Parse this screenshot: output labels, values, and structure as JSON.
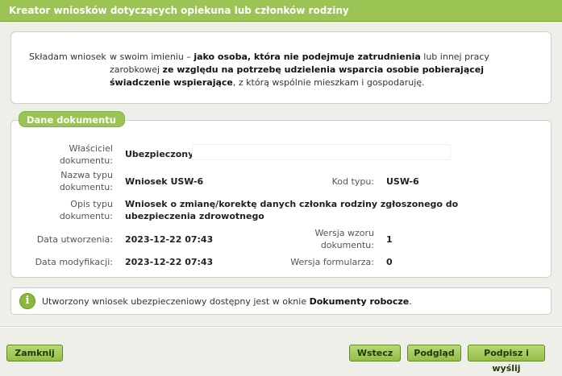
{
  "window": {
    "title": "Kreator wniosków dotyczących opiekuna lub członków rodziny"
  },
  "intro": {
    "label": "Składam wniosek",
    "text_1": "w swoim imieniu – ",
    "text_2": "jako osoba, która nie podejmuje zatrudnienia",
    "text_3": " lub innej pracy zarobkowej ",
    "text_4": "ze względu na potrzebę udzielenia wsparcia osobie pobierającej świadczenie wspierające",
    "text_5": ", z którą wspólnie mieszkam i gospodaruję."
  },
  "document": {
    "section_title": "Dane dokumentu",
    "owner_label": "Właściciel dokumentu:",
    "owner_value": "Ubezpieczony",
    "type_name_label": "Nazwa typu dokumentu:",
    "type_name_value": "Wniosek USW-6",
    "type_code_label": "Kod typu:",
    "type_code_value": "USW-6",
    "type_desc_label": "Opis typu dokumentu:",
    "type_desc_value": "Wniosek o zmianę/korektę danych członka rodziny zgłoszonego do ubezpieczenia zdrowotnego",
    "created_label": "Data utworzenia:",
    "created_value": "2023-12-22 07:43",
    "template_version_label": "Wersja wzoru dokumentu:",
    "template_version_value": "1",
    "modified_label": "Data modyfikacji:",
    "modified_value": "2023-12-22 07:43",
    "form_version_label": "Wersja formularza:",
    "form_version_value": "0"
  },
  "info": {
    "icon": "info-icon",
    "text_1": "Utworzony wniosek ubezpieczeniowy dostępny jest w oknie ",
    "text_2": "Dokumenty robocze",
    "text_3": "."
  },
  "buttons": {
    "close": "Zamknij",
    "back": "Wstecz",
    "preview": "Podgląd",
    "sign_send": "Podpisz i wyślij"
  }
}
